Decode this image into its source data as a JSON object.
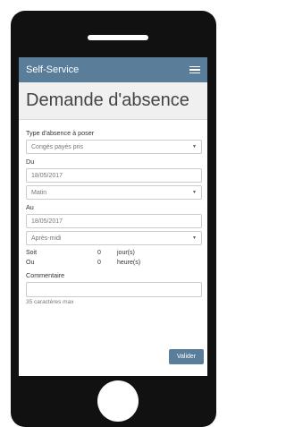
{
  "app": {
    "name": "Self-Service",
    "menu_icon": "hamburger-menu-icon"
  },
  "page": {
    "title": "Demande d'absence"
  },
  "form": {
    "type_label": "Type d'absence à poser",
    "type_value": "Congés payés pris",
    "du_label": "Du",
    "du_date": "18/05/2017",
    "du_period": "Matin",
    "au_label": "Au",
    "au_date": "18/05/2017",
    "au_period": "Après-midi",
    "soit_label": "Soit",
    "soit_value": "0",
    "soit_unit": "jour(s)",
    "ou_label": "Ou",
    "ou_value": "0",
    "ou_unit": "heure(s)",
    "comment_label": "Commentaire",
    "comment_hint": "35 caractères max",
    "submit_label": "Valider"
  }
}
